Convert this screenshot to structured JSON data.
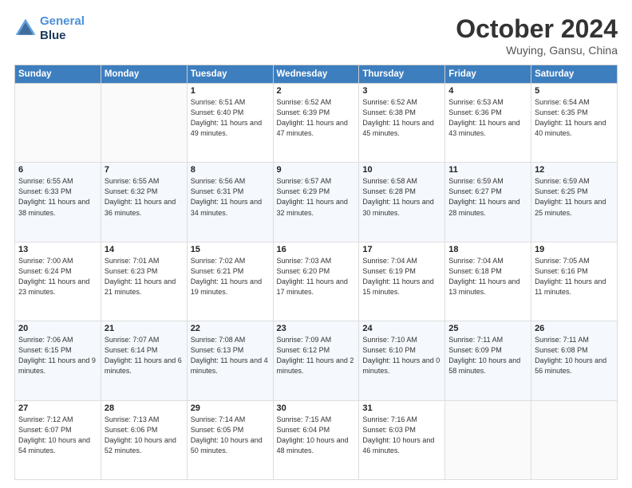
{
  "header": {
    "logo_line1": "General",
    "logo_line2": "Blue",
    "month": "October 2024",
    "location": "Wuying, Gansu, China"
  },
  "weekdays": [
    "Sunday",
    "Monday",
    "Tuesday",
    "Wednesday",
    "Thursday",
    "Friday",
    "Saturday"
  ],
  "weeks": [
    [
      {
        "day": "",
        "info": ""
      },
      {
        "day": "",
        "info": ""
      },
      {
        "day": "1",
        "info": "Sunrise: 6:51 AM\nSunset: 6:40 PM\nDaylight: 11 hours and 49 minutes."
      },
      {
        "day": "2",
        "info": "Sunrise: 6:52 AM\nSunset: 6:39 PM\nDaylight: 11 hours and 47 minutes."
      },
      {
        "day": "3",
        "info": "Sunrise: 6:52 AM\nSunset: 6:38 PM\nDaylight: 11 hours and 45 minutes."
      },
      {
        "day": "4",
        "info": "Sunrise: 6:53 AM\nSunset: 6:36 PM\nDaylight: 11 hours and 43 minutes."
      },
      {
        "day": "5",
        "info": "Sunrise: 6:54 AM\nSunset: 6:35 PM\nDaylight: 11 hours and 40 minutes."
      }
    ],
    [
      {
        "day": "6",
        "info": "Sunrise: 6:55 AM\nSunset: 6:33 PM\nDaylight: 11 hours and 38 minutes."
      },
      {
        "day": "7",
        "info": "Sunrise: 6:55 AM\nSunset: 6:32 PM\nDaylight: 11 hours and 36 minutes."
      },
      {
        "day": "8",
        "info": "Sunrise: 6:56 AM\nSunset: 6:31 PM\nDaylight: 11 hours and 34 minutes."
      },
      {
        "day": "9",
        "info": "Sunrise: 6:57 AM\nSunset: 6:29 PM\nDaylight: 11 hours and 32 minutes."
      },
      {
        "day": "10",
        "info": "Sunrise: 6:58 AM\nSunset: 6:28 PM\nDaylight: 11 hours and 30 minutes."
      },
      {
        "day": "11",
        "info": "Sunrise: 6:59 AM\nSunset: 6:27 PM\nDaylight: 11 hours and 28 minutes."
      },
      {
        "day": "12",
        "info": "Sunrise: 6:59 AM\nSunset: 6:25 PM\nDaylight: 11 hours and 25 minutes."
      }
    ],
    [
      {
        "day": "13",
        "info": "Sunrise: 7:00 AM\nSunset: 6:24 PM\nDaylight: 11 hours and 23 minutes."
      },
      {
        "day": "14",
        "info": "Sunrise: 7:01 AM\nSunset: 6:23 PM\nDaylight: 11 hours and 21 minutes."
      },
      {
        "day": "15",
        "info": "Sunrise: 7:02 AM\nSunset: 6:21 PM\nDaylight: 11 hours and 19 minutes."
      },
      {
        "day": "16",
        "info": "Sunrise: 7:03 AM\nSunset: 6:20 PM\nDaylight: 11 hours and 17 minutes."
      },
      {
        "day": "17",
        "info": "Sunrise: 7:04 AM\nSunset: 6:19 PM\nDaylight: 11 hours and 15 minutes."
      },
      {
        "day": "18",
        "info": "Sunrise: 7:04 AM\nSunset: 6:18 PM\nDaylight: 11 hours and 13 minutes."
      },
      {
        "day": "19",
        "info": "Sunrise: 7:05 AM\nSunset: 6:16 PM\nDaylight: 11 hours and 11 minutes."
      }
    ],
    [
      {
        "day": "20",
        "info": "Sunrise: 7:06 AM\nSunset: 6:15 PM\nDaylight: 11 hours and 9 minutes."
      },
      {
        "day": "21",
        "info": "Sunrise: 7:07 AM\nSunset: 6:14 PM\nDaylight: 11 hours and 6 minutes."
      },
      {
        "day": "22",
        "info": "Sunrise: 7:08 AM\nSunset: 6:13 PM\nDaylight: 11 hours and 4 minutes."
      },
      {
        "day": "23",
        "info": "Sunrise: 7:09 AM\nSunset: 6:12 PM\nDaylight: 11 hours and 2 minutes."
      },
      {
        "day": "24",
        "info": "Sunrise: 7:10 AM\nSunset: 6:10 PM\nDaylight: 11 hours and 0 minutes."
      },
      {
        "day": "25",
        "info": "Sunrise: 7:11 AM\nSunset: 6:09 PM\nDaylight: 10 hours and 58 minutes."
      },
      {
        "day": "26",
        "info": "Sunrise: 7:11 AM\nSunset: 6:08 PM\nDaylight: 10 hours and 56 minutes."
      }
    ],
    [
      {
        "day": "27",
        "info": "Sunrise: 7:12 AM\nSunset: 6:07 PM\nDaylight: 10 hours and 54 minutes."
      },
      {
        "day": "28",
        "info": "Sunrise: 7:13 AM\nSunset: 6:06 PM\nDaylight: 10 hours and 52 minutes."
      },
      {
        "day": "29",
        "info": "Sunrise: 7:14 AM\nSunset: 6:05 PM\nDaylight: 10 hours and 50 minutes."
      },
      {
        "day": "30",
        "info": "Sunrise: 7:15 AM\nSunset: 6:04 PM\nDaylight: 10 hours and 48 minutes."
      },
      {
        "day": "31",
        "info": "Sunrise: 7:16 AM\nSunset: 6:03 PM\nDaylight: 10 hours and 46 minutes."
      },
      {
        "day": "",
        "info": ""
      },
      {
        "day": "",
        "info": ""
      }
    ]
  ]
}
